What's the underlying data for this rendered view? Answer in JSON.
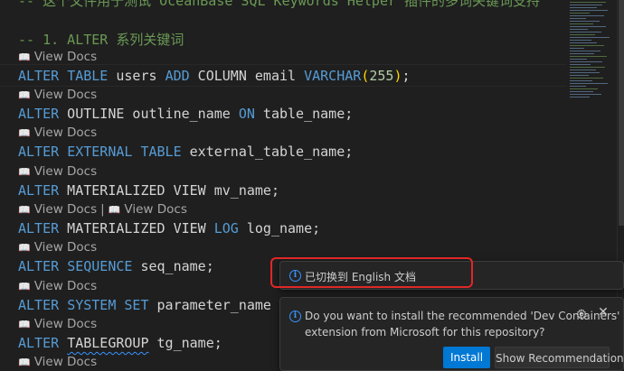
{
  "top_comment": "-- 这个文件用于测试 OceanBase SQL Keywords Helper 插件的多词关键词支持",
  "section_comment": "-- 1. ALTER 系列关键词",
  "codelens": {
    "book_icon": "📖",
    "view_docs": "View Docs",
    "separator": "|"
  },
  "code_lines": [
    {
      "tokens": [
        {
          "t": "ALTER",
          "c": "kw"
        },
        {
          "t": " "
        },
        {
          "t": "TABLE",
          "c": "kw"
        },
        {
          "t": " users "
        },
        {
          "t": "ADD",
          "c": "kw"
        },
        {
          "t": " COLUMN email "
        },
        {
          "t": "VARCHAR",
          "c": "kw"
        },
        {
          "t": "(",
          "c": "paren"
        },
        {
          "t": "255",
          "c": "num"
        },
        {
          "t": ")",
          "c": "paren"
        },
        {
          "t": ";"
        }
      ]
    },
    {
      "tokens": [
        {
          "t": "ALTER",
          "c": "kw"
        },
        {
          "t": " OUTLINE outline_name "
        },
        {
          "t": "ON",
          "c": "kw"
        },
        {
          "t": " table_name;"
        }
      ]
    },
    {
      "tokens": [
        {
          "t": "ALTER",
          "c": "kw"
        },
        {
          "t": " "
        },
        {
          "t": "EXTERNAL",
          "c": "kw"
        },
        {
          "t": " "
        },
        {
          "t": "TABLE",
          "c": "kw"
        },
        {
          "t": " external_table_name;"
        }
      ]
    },
    {
      "tokens": [
        {
          "t": "ALTER",
          "c": "kw"
        },
        {
          "t": " MATERIALIZED VIEW mv_name;"
        }
      ]
    },
    {
      "tokens": [
        {
          "t": "ALTER",
          "c": "kw"
        },
        {
          "t": " MATERIALIZED VIEW "
        },
        {
          "t": "LOG",
          "c": "kw"
        },
        {
          "t": " log_name;"
        }
      ]
    },
    {
      "tokens": [
        {
          "t": "ALTER",
          "c": "kw"
        },
        {
          "t": " "
        },
        {
          "t": "SEQUENCE",
          "c": "kw"
        },
        {
          "t": " seq_name;"
        }
      ]
    },
    {
      "tokens": [
        {
          "t": "ALTER",
          "c": "kw"
        },
        {
          "t": " "
        },
        {
          "t": "SYSTEM",
          "c": "kw"
        },
        {
          "t": " "
        },
        {
          "t": "SET",
          "c": "kw"
        },
        {
          "t": " parameter_name = value;"
        }
      ]
    },
    {
      "tokens": [
        {
          "t": "ALTER",
          "c": "kw"
        },
        {
          "t": " "
        },
        {
          "t": "TABLEGROUP",
          "c": "squiggle"
        },
        {
          "t": " tg_name;"
        }
      ]
    }
  ],
  "toast_switch": {
    "icon": "info-icon",
    "message": "已切换到 English 文档"
  },
  "toast_recommend": {
    "icon": "info-icon",
    "message_line1": "Do you want to install the recommended 'Dev Containers'",
    "message_line2": "extension from Microsoft for this repository?",
    "install_label": "Install",
    "show_label": "Show Recommendations",
    "close_glyph": "✕"
  },
  "colors": {
    "background": "#1f1f1f",
    "keyword": "#569cd6",
    "comment": "#6a9955",
    "accent": "#0078d4",
    "highlight_box": "#e02727"
  }
}
